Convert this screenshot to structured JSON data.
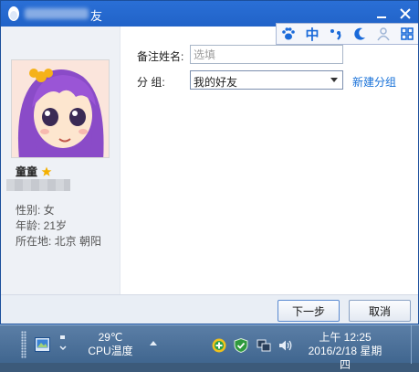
{
  "window": {
    "title_suffix": "友",
    "minimize_icon": "minimize-icon",
    "close_icon": "close-icon"
  },
  "ime_bar": {
    "items": [
      "paw-icon",
      "中",
      "punctuation-icon",
      "moon-icon",
      "user-icon",
      "grid-icon"
    ],
    "mode_label": "中"
  },
  "profile": {
    "nickname": "童童",
    "gender": "性别: 女",
    "age": "年龄: 21岁",
    "location": "所在地: 北京  朝阳"
  },
  "form": {
    "remark_label": "备注姓名:",
    "remark_placeholder": "选填",
    "remark_value": "",
    "group_label": "分    组:",
    "group_value": "我的好友",
    "new_group_link": "新建分组"
  },
  "buttons": {
    "next": "下一步",
    "cancel": "取消"
  },
  "taskbar": {
    "temperature": "29℃",
    "temperature_label": "CPU温度",
    "time": "上午 12:25",
    "date": "2016/2/18 星期四"
  },
  "colors": {
    "titlebar": "#2163c8",
    "link": "#1670d8",
    "taskbar": "#4a6f98"
  }
}
